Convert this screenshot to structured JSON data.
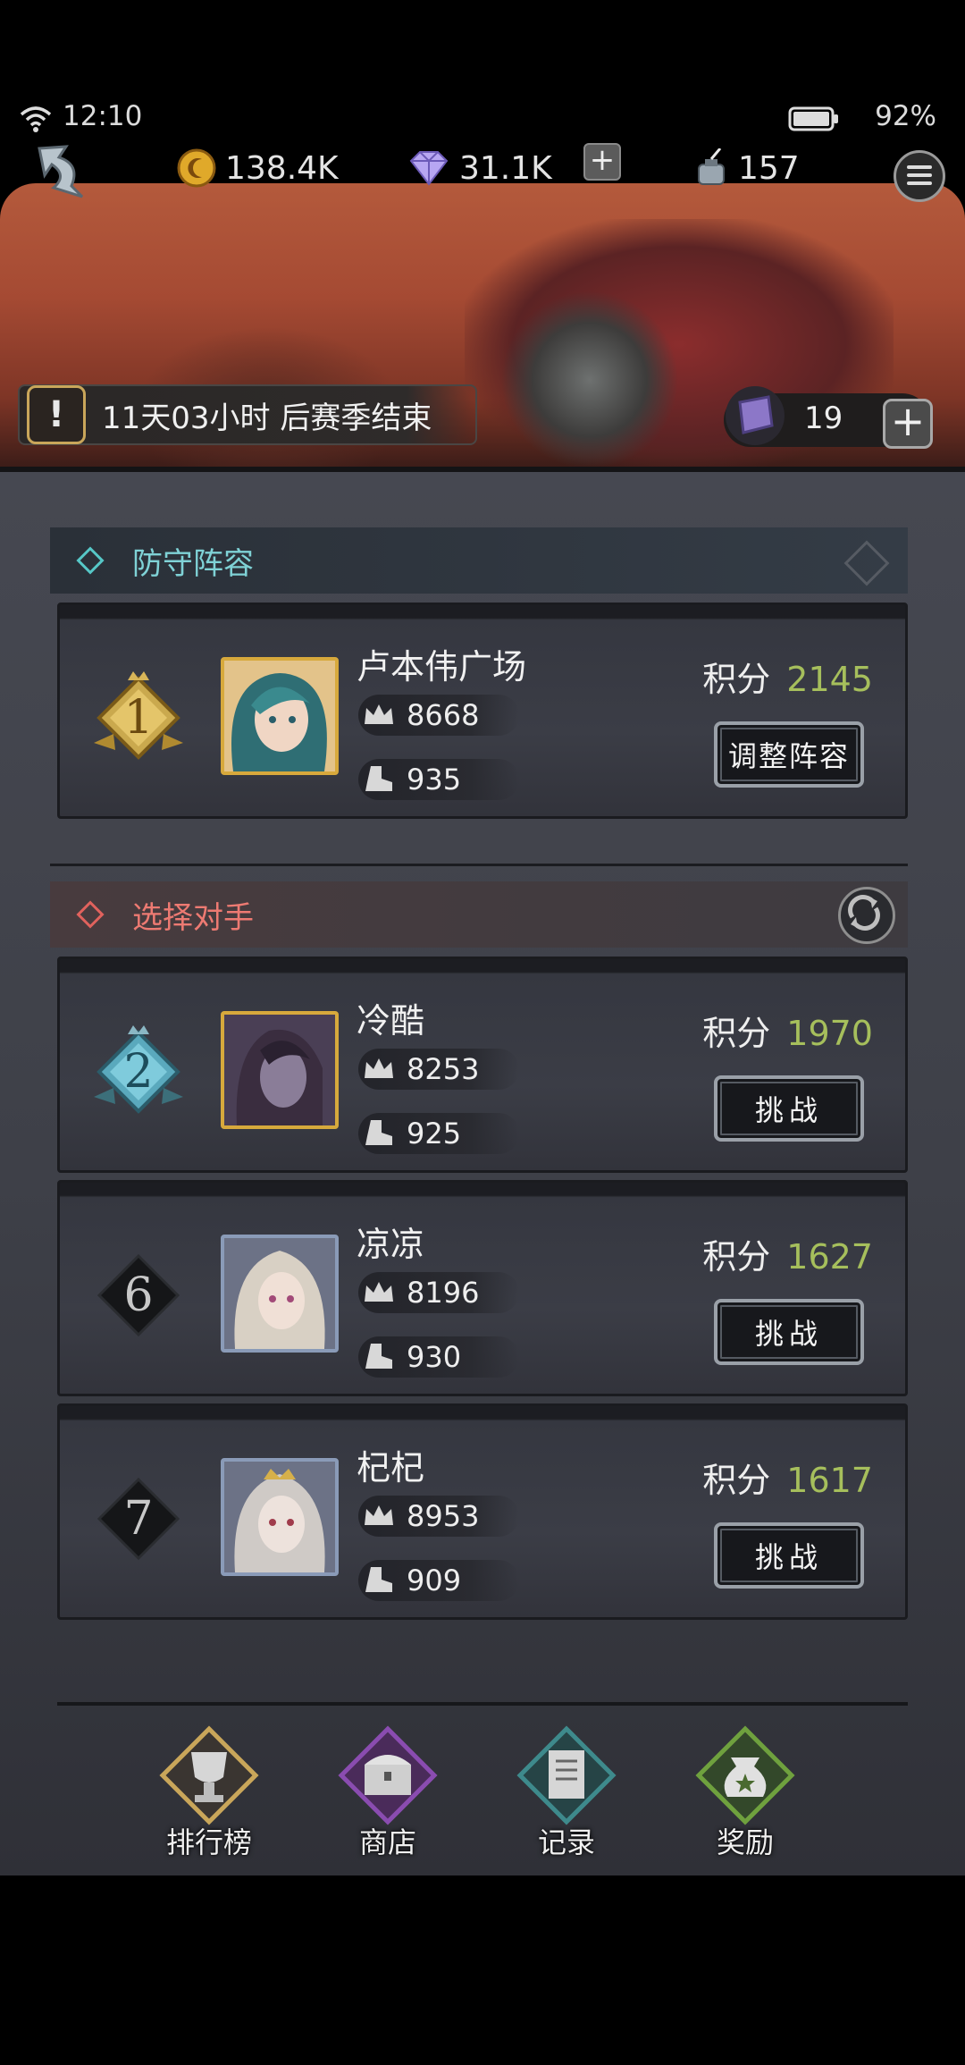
{
  "status_bar": {
    "time": "12:10",
    "battery": "92%"
  },
  "resources": {
    "gold": "138.4K",
    "diamond": "31.1K",
    "ink": "157"
  },
  "season": {
    "text": "11天03小时 后赛季结束",
    "tickets": "19"
  },
  "defense": {
    "title": "防守阵容",
    "player": {
      "rank": "1",
      "name": "卢本伟广场",
      "power": "8668",
      "speed": "935",
      "score_label": "积分",
      "score": "2145",
      "button": "调整阵容"
    }
  },
  "opponents": {
    "title": "选择对手",
    "list": [
      {
        "rank": "2",
        "name": "冷酷",
        "power": "8253",
        "speed": "925",
        "score_label": "积分",
        "score": "1970",
        "button": "挑战"
      },
      {
        "rank": "6",
        "name": "凉凉",
        "power": "8196",
        "speed": "930",
        "score_label": "积分",
        "score": "1627",
        "button": "挑战"
      },
      {
        "rank": "7",
        "name": "杞杞",
        "power": "8953",
        "speed": "909",
        "score_label": "积分",
        "score": "1617",
        "button": "挑战"
      }
    ]
  },
  "nav": [
    {
      "label": "排行榜",
      "icon": "trophy-icon",
      "color": "#c9a65a"
    },
    {
      "label": "商店",
      "icon": "chest-icon",
      "color": "#8a4cb0"
    },
    {
      "label": "记录",
      "icon": "scroll-icon",
      "color": "#3e8a8c"
    },
    {
      "label": "奖励",
      "icon": "moneybag-icon",
      "color": "#6fa13e"
    }
  ],
  "colors": {
    "score_green": "#a6bf5c",
    "defense_accent": "#7fd2d6",
    "opponent_accent": "#ed7a72"
  }
}
